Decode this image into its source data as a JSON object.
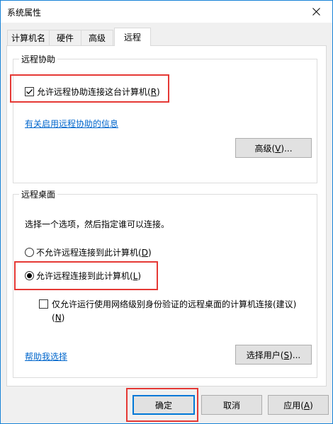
{
  "window": {
    "title": "系统属性"
  },
  "tabs": [
    {
      "label": "计算机名"
    },
    {
      "label": "硬件"
    },
    {
      "label": "高级"
    },
    {
      "label": "远程",
      "active": true
    }
  ],
  "remote_assistance": {
    "group_label": "远程协助",
    "allow_checkbox": {
      "label": "允许远程协助连接这台计算机(",
      "key": "R",
      "suffix": ")",
      "checked": true
    },
    "info_link": "有关启用远程协助的信息",
    "advanced_button": {
      "label": "高级(",
      "key": "V",
      "suffix": ")..."
    }
  },
  "remote_desktop": {
    "group_label": "远程桌面",
    "instruction": "选择一个选项，然后指定谁可以连接。",
    "option_disallow": {
      "label": "不允许远程连接到此计算机(",
      "key": "D",
      "suffix": ")",
      "selected": false
    },
    "option_allow": {
      "label": "允许远程连接到此计算机(",
      "key": "L",
      "suffix": ")",
      "selected": true
    },
    "nla_checkbox": {
      "label": "仅允许运行使用网络级别身份验证的远程桌面的计算机连接(建议)",
      "line2_prefix": "(",
      "key": "N",
      "suffix": ")",
      "checked": false
    },
    "help_link": "帮助我选择",
    "select_users_button": {
      "label": "选择用户(",
      "key": "S",
      "suffix": ")..."
    }
  },
  "footer": {
    "ok_button": "确定",
    "cancel_button": "取消",
    "apply_button": {
      "label": "应用(",
      "key": "A",
      "suffix": ")"
    }
  },
  "colors": {
    "accent": "#0078d7",
    "link": "#0066cc",
    "highlight": "#e53935"
  }
}
